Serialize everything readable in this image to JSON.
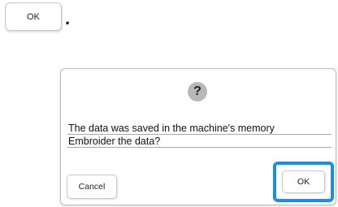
{
  "reference": {
    "ok_label": "OK",
    "punctuation": "."
  },
  "dialog": {
    "icon": "question-icon",
    "icon_glyph": "?",
    "message_lines": [
      "The data was saved in the machine's memory",
      "Embroider the data?"
    ],
    "cancel_label": "Cancel",
    "ok_label": "OK",
    "highlight_color": "#1a8fe0"
  }
}
